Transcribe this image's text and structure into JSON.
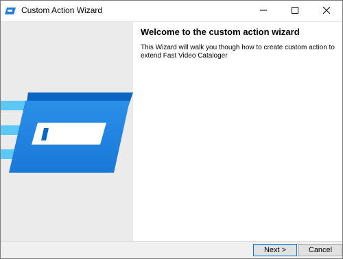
{
  "window": {
    "title": "Custom Action Wizard",
    "app_icon": "wizard-app-icon",
    "controls": {
      "minimize": "minimize-icon",
      "maximize": "maximize-icon",
      "close": "close-icon"
    }
  },
  "side_panel": {
    "illustration": "wizard-illustration",
    "colors": {
      "panel": "#ebebeb",
      "card_dark": "#0a66c2",
      "card_light": "#2b8fe8",
      "stripe": "#5cc8f5"
    }
  },
  "content": {
    "heading": "Welcome to the custom action wizard",
    "description": "This Wizard will walk you though how to create custom action to extend Fast Video Cataloger"
  },
  "footer": {
    "next_label": "Next >",
    "cancel_label": "Cancel"
  },
  "colors": {
    "accent": "#0078d7"
  }
}
